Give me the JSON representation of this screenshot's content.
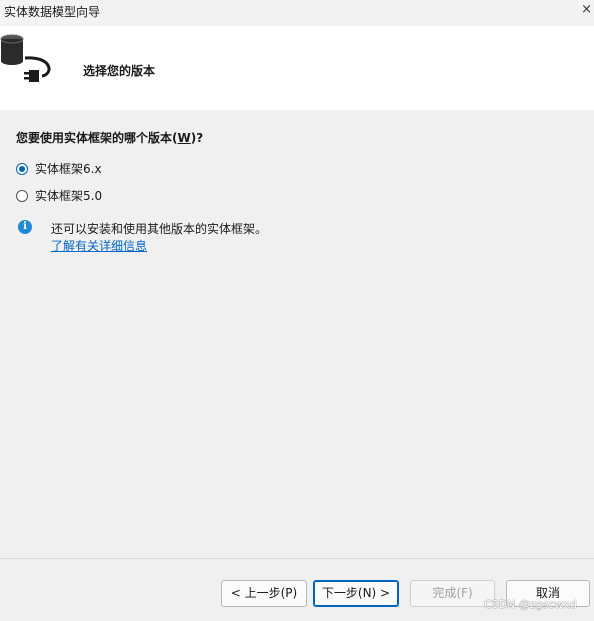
{
  "window": {
    "title": "实体数据模型向导",
    "close_glyph": "×"
  },
  "header": {
    "title": "选择您的版本",
    "icon": "database-plug-icon"
  },
  "question": {
    "text": "您要使用实体框架的哪个版本(",
    "accelerator": "W",
    "suffix": ")?"
  },
  "options": [
    {
      "label": "实体框架6.x",
      "selected": true
    },
    {
      "label": "实体框架5.0",
      "selected": false
    }
  ],
  "info": {
    "icon": "info-icon",
    "text": "还可以安装和使用其他版本的实体框架。",
    "link": "了解有关详细信息"
  },
  "buttons": {
    "back": "< 上一步(P)",
    "next": "下一步(N) >",
    "finish": "完成(F)",
    "cancel": "取消"
  },
  "watermark": "CSDN @zgscwxd",
  "colors": {
    "accent": "#0067c0",
    "link": "#0066cc",
    "info": "#1e8ad6"
  }
}
